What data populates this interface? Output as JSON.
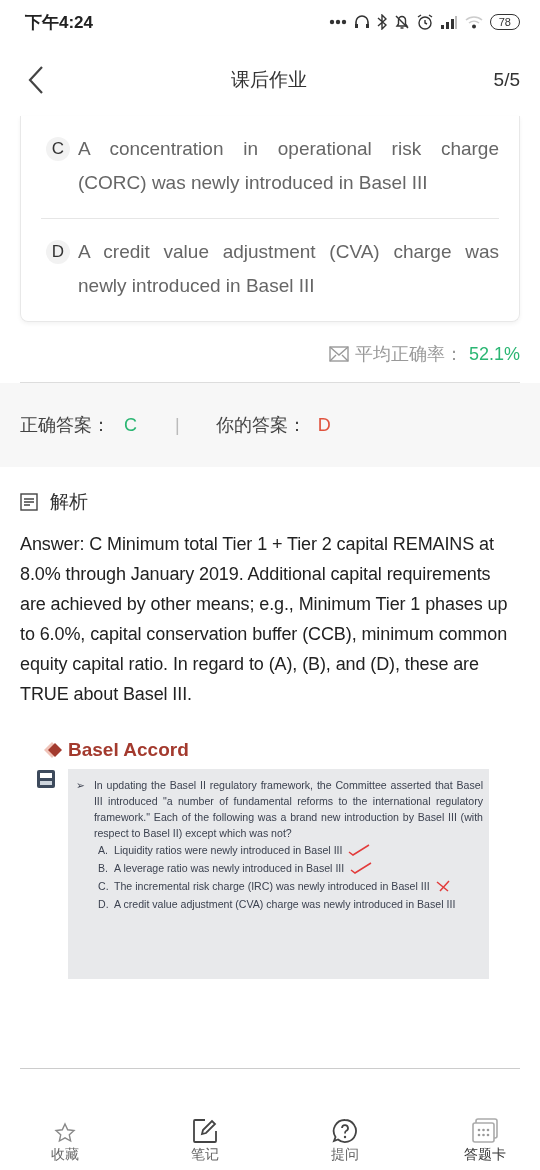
{
  "status_bar": {
    "time": "下午4:24",
    "battery": "78"
  },
  "header": {
    "title": "课后作业",
    "progress": "5/5"
  },
  "options": [
    {
      "letter": "C",
      "text": "A concentration in operational risk charge (CORC) was newly introduced in Basel III"
    },
    {
      "letter": "D",
      "text": "A credit value adjustment (CVA) charge was newly introduced in Basel III"
    }
  ],
  "average": {
    "label": "平均正确率：",
    "value": "52.1%"
  },
  "answers": {
    "correct_label": "正确答案：",
    "correct": "C",
    "separator": "|",
    "yours_label": "你的答案：",
    "yours": "D"
  },
  "analysis": {
    "title": "解析",
    "text": "Answer: C Minimum total Tier 1 + Tier 2 capital REMAINS at 8.0% through January 2019. Additional capital requirements are achieved by other means; e.g., Minimum Tier 1 phases up to 6.0%, capital conservation buffer (CCB), minimum common equity capital ratio. In regard to (A), (B), and (D), these are TRUE about Basel III."
  },
  "slide": {
    "title": "Basel Accord",
    "bullet": "➢",
    "question": "In updating the Basel II regulatory framework, the Committee asserted that Basel III introduced \"a number of fundamental reforms to the international regulatory framework.\" Each of the following was a brand new introduction by Basel III (with respect to Basel II) except which was not?",
    "options": [
      {
        "letter": "A.",
        "text": "Liquidity ratios were newly introduced in Basel III",
        "ticked": true,
        "crossed": false
      },
      {
        "letter": "B.",
        "text": "A leverage ratio was newly introduced in Basel III",
        "ticked": true,
        "crossed": false
      },
      {
        "letter": "C.",
        "text": "The incremental risk charge (IRC) was newly introduced in Basel III",
        "ticked": false,
        "crossed": true
      },
      {
        "letter": "D.",
        "text": "A credit value adjustment (CVA) charge was newly introduced in Basel III",
        "ticked": false,
        "crossed": false
      }
    ]
  },
  "tab_bar": [
    {
      "label": "收藏",
      "kind": "star"
    },
    {
      "label": "笔记",
      "kind": "note"
    },
    {
      "label": "提问",
      "kind": "question"
    },
    {
      "label": "答题卡",
      "kind": "card"
    }
  ]
}
